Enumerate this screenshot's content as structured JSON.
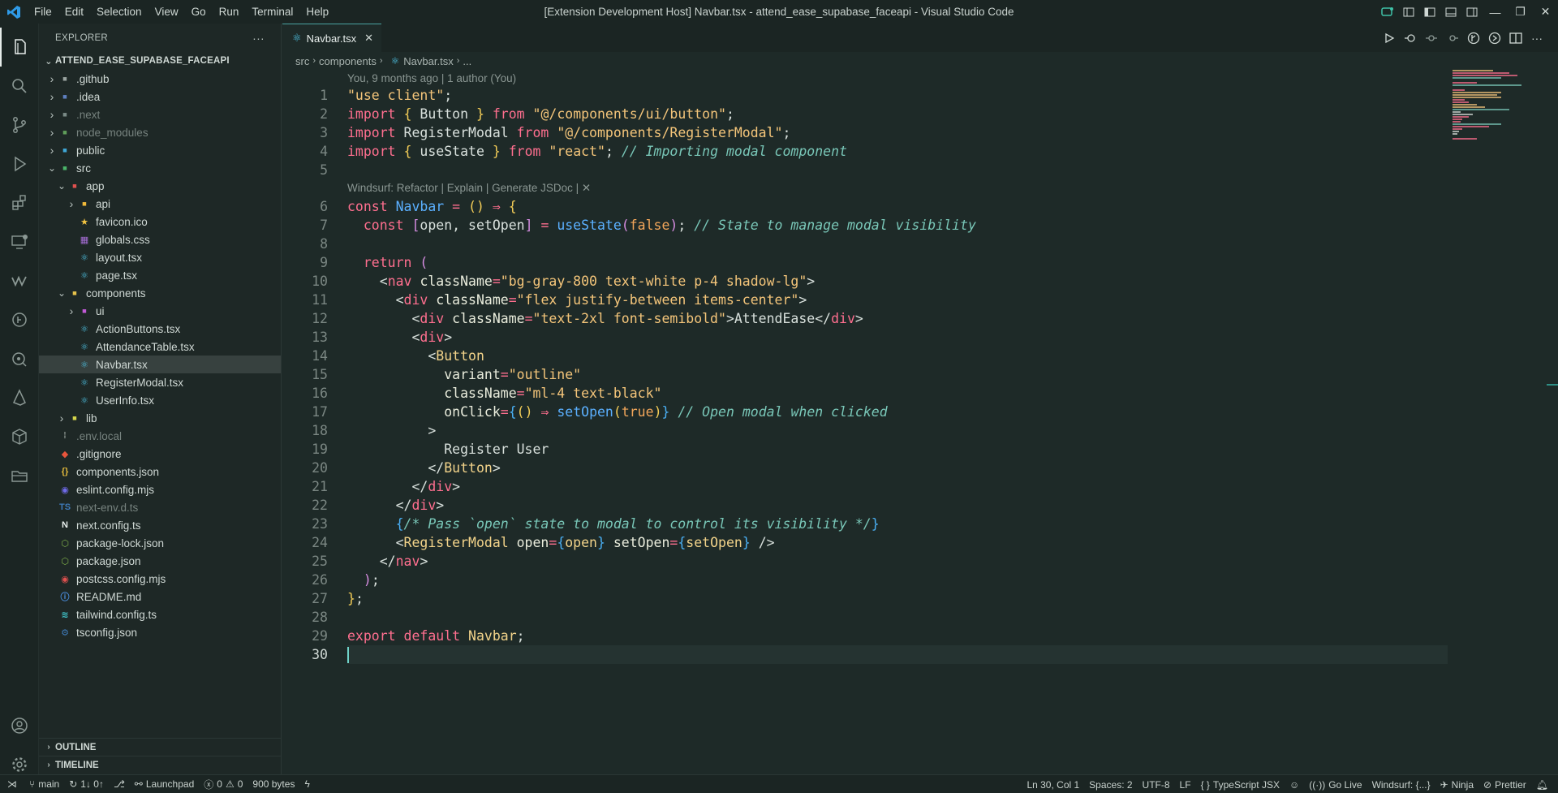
{
  "window": {
    "title": "[Extension Development Host] Navbar.tsx - attend_ease_supabase_faceapi - Visual Studio Code",
    "menu": [
      "File",
      "Edit",
      "Selection",
      "View",
      "Go",
      "Run",
      "Terminal",
      "Help"
    ]
  },
  "colors": {
    "accent": "#4aa3a0",
    "keyword": "#ff6f8f",
    "string": "#f4c57a",
    "function": "#5bb0ff",
    "comment": "#79c7b8"
  },
  "sidebar": {
    "header": "EXPLORER",
    "more": "···",
    "project": "ATTEND_EASE_SUPABASE_FACEAPI",
    "items": [
      {
        "label": ".github",
        "icon": "folder-github-icon"
      },
      {
        "label": ".idea",
        "icon": "folder-idea-icon"
      },
      {
        "label": ".next",
        "icon": "folder-next-icon"
      },
      {
        "label": "node_modules",
        "icon": "folder-node-icon"
      },
      {
        "label": "public",
        "icon": "folder-public-icon"
      },
      {
        "label": "src",
        "icon": "folder-src-icon"
      },
      {
        "label": "app",
        "icon": "folder-app-icon"
      },
      {
        "label": "api",
        "icon": "folder-api-icon"
      },
      {
        "label": "favicon.ico",
        "icon": "star-icon"
      },
      {
        "label": "globals.css",
        "icon": "css-icon"
      },
      {
        "label": "layout.tsx",
        "icon": "react-icon"
      },
      {
        "label": "page.tsx",
        "icon": "react-icon"
      },
      {
        "label": "components",
        "icon": "folder-components-icon"
      },
      {
        "label": "ui",
        "icon": "folder-ui-icon"
      },
      {
        "label": "ActionButtons.tsx",
        "icon": "react-icon"
      },
      {
        "label": "AttendanceTable.tsx",
        "icon": "react-icon"
      },
      {
        "label": "Navbar.tsx",
        "icon": "react-icon"
      },
      {
        "label": "RegisterModal.tsx",
        "icon": "react-icon"
      },
      {
        "label": "UserInfo.tsx",
        "icon": "react-icon"
      },
      {
        "label": "lib",
        "icon": "folder-lib-icon"
      },
      {
        "label": ".env.local",
        "icon": "env-icon"
      },
      {
        "label": ".gitignore",
        "icon": "git-icon"
      },
      {
        "label": "components.json",
        "icon": "json-icon"
      },
      {
        "label": "eslint.config.mjs",
        "icon": "eslint-icon"
      },
      {
        "label": "next-env.d.ts",
        "icon": "ts-def-icon"
      },
      {
        "label": "next.config.ts",
        "icon": "next-icon"
      },
      {
        "label": "package-lock.json",
        "icon": "npm-icon"
      },
      {
        "label": "package.json",
        "icon": "npm-icon"
      },
      {
        "label": "postcss.config.mjs",
        "icon": "postcss-icon"
      },
      {
        "label": "README.md",
        "icon": "info-icon"
      },
      {
        "label": "tailwind.config.ts",
        "icon": "tailwind-icon"
      },
      {
        "label": "tsconfig.json",
        "icon": "tsconfig-icon"
      }
    ],
    "outline": "OUTLINE",
    "timeline": "TIMELINE"
  },
  "editor": {
    "tab": "Navbar.tsx",
    "breadcrumb": [
      "src",
      "components",
      "Navbar.tsx",
      "..."
    ],
    "blame": "You, 9 months ago | 1 author (You)",
    "codelens": "Windsurf: Refactor | Explain | Generate JSDoc | ✕",
    "line_numbers": [
      "1",
      "2",
      "3",
      "4",
      "5",
      "6",
      "7",
      "8",
      "9",
      "10",
      "11",
      "12",
      "13",
      "14",
      "15",
      "16",
      "17",
      "18",
      "19",
      "20",
      "21",
      "22",
      "23",
      "24",
      "25",
      "26",
      "27",
      "28",
      "29",
      "30"
    ]
  },
  "status": {
    "branch": "main",
    "sync": "1↓ 0↑",
    "launchpad": "Launchpad",
    "problems": "0",
    "warnings": "0",
    "size": "900 bytes",
    "position": "Ln 30, Col 1",
    "spaces": "Spaces: 2",
    "encoding": "UTF-8",
    "eol": "LF",
    "language": "TypeScript JSX",
    "golive": "Go Live",
    "windsurf": "Windsurf: {...}",
    "ninja": "Ninja",
    "prettier": "Prettier"
  }
}
